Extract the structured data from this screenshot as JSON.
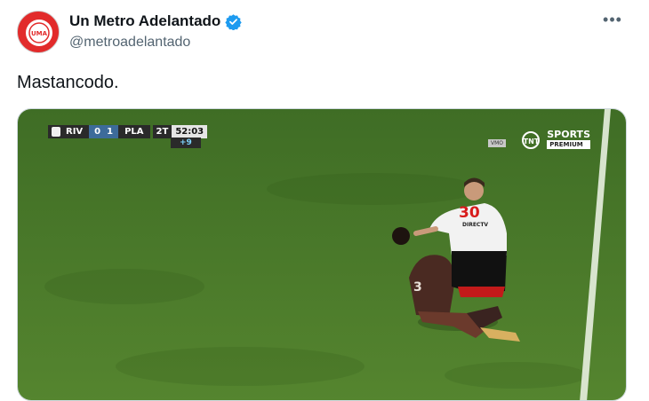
{
  "account": {
    "display_name": "Un Metro Adelantado",
    "handle": "@metroadelantado",
    "avatar_text": "UMA"
  },
  "tweet": {
    "text": "Mastancodo."
  },
  "scoreboard": {
    "home_team": "RIV",
    "home_score": "0",
    "away_score": "1",
    "away_team": "PLA",
    "half": "2T",
    "clock": "52:03",
    "added_time": "+9"
  },
  "broadcast": {
    "channel_logo": "TNT",
    "channel": "SPORTS",
    "tier": "PREMIUM",
    "rating_badge": "VMO"
  },
  "players": {
    "white_jersey_number": "30",
    "dark_jersey_number": "3"
  },
  "colors": {
    "verified_blue": "#1d9bf0",
    "pitch_green": "#4a7a2a",
    "avatar_red": "#e22b2b"
  }
}
